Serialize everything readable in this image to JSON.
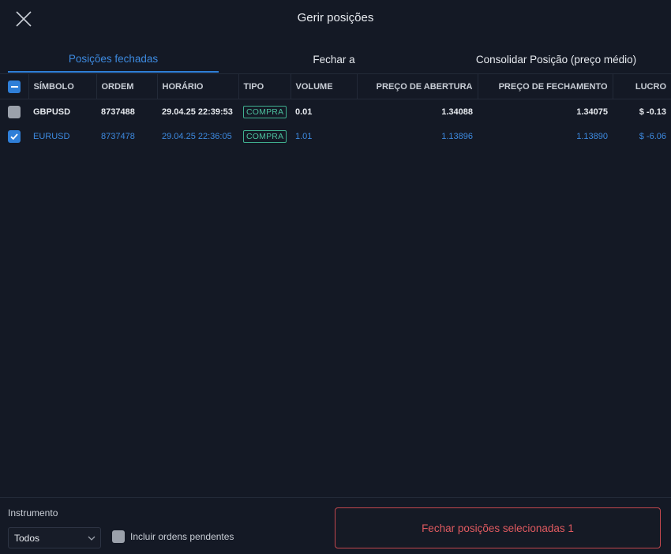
{
  "header": {
    "title": "Gerir posições"
  },
  "tabs": [
    {
      "label": "Posições fechadas",
      "active": true
    },
    {
      "label": "Fechar a",
      "active": false
    },
    {
      "label": "Consolidar Posição (preço médio)",
      "active": false
    }
  ],
  "table": {
    "columns": [
      "SÍMBOLO",
      "ORDEM",
      "HORÁRIO",
      "TIPO",
      "VOLUME",
      "PREÇO DE ABERTURA",
      "PREÇO DE FECHAMENTO",
      "LUCRO"
    ],
    "rows": [
      {
        "selected": false,
        "symbol": "GBPUSD",
        "order": "8737488",
        "time": "29.04.25 22:39:53",
        "type": "COMPRA",
        "volume": "0.01",
        "open_price": "1.34088",
        "close_price": "1.34075",
        "profit": "$ -0.13"
      },
      {
        "selected": true,
        "symbol": "EURUSD",
        "order": "8737478",
        "time": "29.04.25 22:36:05",
        "type": "COMPRA",
        "volume": "1.01",
        "open_price": "1.13896",
        "close_price": "1.13890",
        "profit": "$ -6.06"
      }
    ]
  },
  "footer": {
    "instrument_label": "Instrumento",
    "instrument_value": "Todos",
    "include_pending_label": "Incluir ordens pendentes",
    "include_pending_checked": false,
    "close_selected_label": "Fechar posições selecionadas 1"
  },
  "colors": {
    "background": "#141925",
    "accent": "#2f7fd8",
    "buy_badge": "#3fb08f",
    "danger": "#c2474e"
  },
  "icons": {
    "close": "close-icon",
    "dropdown": "chevron-down-icon",
    "check": "check-icon",
    "partial": "minus-icon"
  }
}
